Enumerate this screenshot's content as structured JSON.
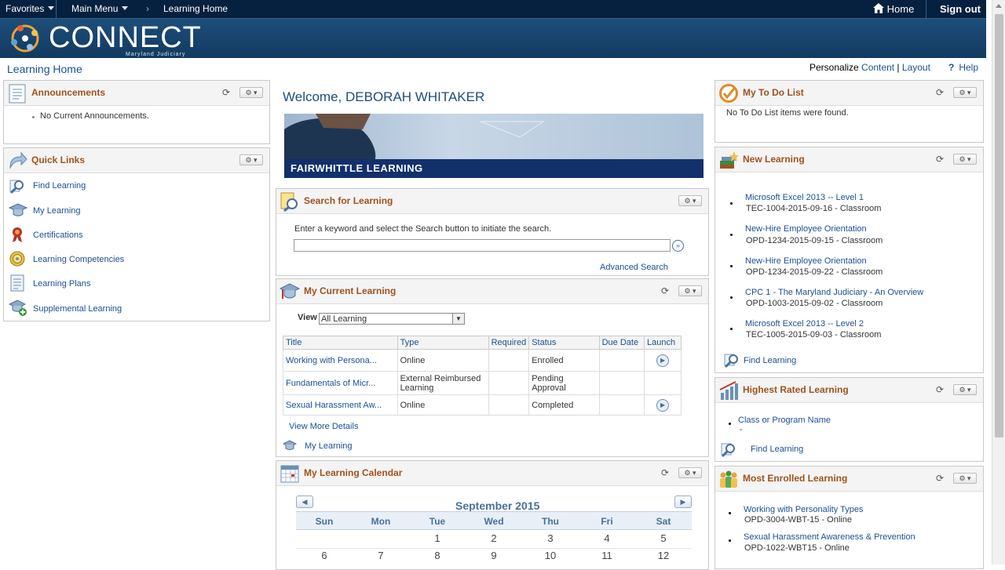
{
  "topnav": {
    "favorites": "Favorites",
    "main_menu": "Main Menu",
    "breadcrumb_sep": "›",
    "breadcrumb": "Learning Home",
    "home": "Home",
    "sign_out": "Sign out"
  },
  "banner": {
    "logo_text": "CONNECT",
    "logo_sub": "Maryland Judiciary"
  },
  "page": {
    "title": "Learning Home",
    "personalize_label": "Personalize",
    "content_link": "Content",
    "divider": "|",
    "layout_link": "Layout",
    "help": "Help"
  },
  "announcements": {
    "title": "Announcements",
    "items": [
      "No Current Announcements."
    ]
  },
  "quick_links": {
    "title": "Quick Links",
    "items": [
      {
        "label": "Find Learning",
        "icon": "magnifier-icon"
      },
      {
        "label": "My Learning",
        "icon": "mortarboard-icon"
      },
      {
        "label": "Certifications",
        "icon": "ribbon-icon"
      },
      {
        "label": "Learning Competencies",
        "icon": "target-icon"
      },
      {
        "label": "Learning Plans",
        "icon": "list-icon"
      },
      {
        "label": "Supplemental Learning",
        "icon": "add-course-icon"
      }
    ]
  },
  "welcome": {
    "text": "Welcome, DEBORAH WHITAKER",
    "banner_caption": "FAIRWHITTLE LEARNING"
  },
  "search": {
    "title": "Search for Learning",
    "instruction": "Enter a keyword and select the Search button to initiate the search.",
    "value": "",
    "advanced": "Advanced Search"
  },
  "current_learning": {
    "title": "My Current Learning",
    "view_label": "View",
    "view_value": "All Learning",
    "columns": [
      "Title",
      "Type",
      "Required",
      "Status",
      "Due Date",
      "Launch"
    ],
    "rows": [
      {
        "title": "Working with Persona...",
        "type": "Online",
        "required": "",
        "status": "Enrolled",
        "due": "",
        "launch": true
      },
      {
        "title": "Fundamentals of Micr...",
        "type": "External Reimbursed Learning",
        "required": "",
        "status": "Pending Approval",
        "due": "",
        "launch": false
      },
      {
        "title": "Sexual Harassment Aw...",
        "type": "Online",
        "required": "",
        "status": "Completed",
        "due": "",
        "launch": true
      }
    ],
    "view_more": "View More Details",
    "my_learning": "My Learning"
  },
  "calendar": {
    "title": "My Learning Calendar",
    "month": "September 2015",
    "days": [
      "Sun",
      "Mon",
      "Tue",
      "Wed",
      "Thu",
      "Fri",
      "Sat"
    ],
    "week1": [
      "",
      "",
      "1",
      "2",
      "3",
      "4",
      "5"
    ],
    "week2": [
      "6",
      "7",
      "8",
      "9",
      "10",
      "11",
      "12"
    ]
  },
  "todo": {
    "title": "My To Do List",
    "empty": "No To Do List items were found."
  },
  "new_learning": {
    "title": "New Learning",
    "items": [
      {
        "name": "Microsoft Excel 2013 -- Level 1",
        "code": "TEC-1004-2015-09-16 - Classroom"
      },
      {
        "name": "New-Hire Employee Orientation",
        "code": "OPD-1234-2015-09-15 - Classroom"
      },
      {
        "name": "New-Hire Employee Orientation",
        "code": "OPD-1234-2015-09-22 - Classroom"
      },
      {
        "name": "CPC 1 - The Maryland Judiciary - An Overview",
        "code": "OPD-1003-2015-09-02 - Classroom"
      },
      {
        "name": "Microsoft Excel 2013 -- Level 2",
        "code": "TEC-1005-2015-09-03 - Classroom"
      }
    ],
    "find": "Find Learning"
  },
  "highest_rated": {
    "title": "Highest Rated Learning",
    "item": "Class or Program Name",
    "sub": "-",
    "find": "Find Learning"
  },
  "most_enrolled": {
    "title": "Most Enrolled Learning",
    "items": [
      {
        "name": "Working with Personality Types",
        "code": "OPD-3004-WBT-15 - Online"
      },
      {
        "name": "Sexual Harassment Awareness & Prevention",
        "code": "OPD-1022-WBT15 - Online"
      }
    ]
  },
  "colors": {
    "nav_bg": "#05213f",
    "banner_bg": "#1d4e7a",
    "title_orange": "#a0521d",
    "link_blue": "#1a4f96"
  }
}
